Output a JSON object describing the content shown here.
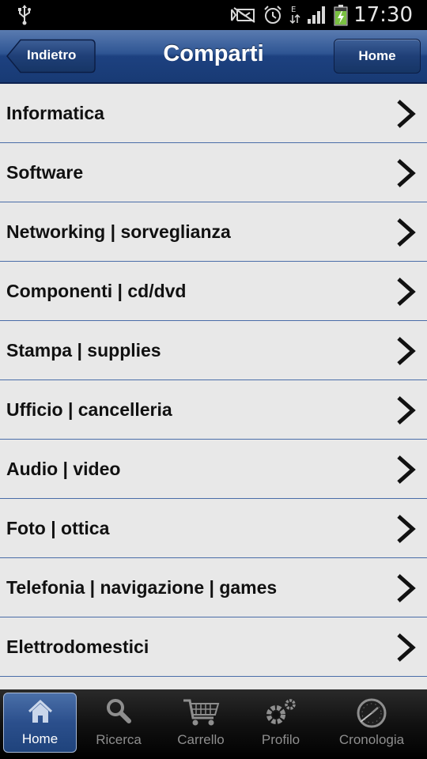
{
  "status_bar": {
    "time": "17:30"
  },
  "nav": {
    "title": "Comparti",
    "back_label": "Indietro",
    "home_label": "Home"
  },
  "list": {
    "items": [
      {
        "label": "Informatica"
      },
      {
        "label": "Software"
      },
      {
        "label": "Networking | sorveglianza"
      },
      {
        "label": "Componenti | cd/dvd"
      },
      {
        "label": "Stampa | supplies"
      },
      {
        "label": "Ufficio | cancelleria"
      },
      {
        "label": "Audio | video"
      },
      {
        "label": "Foto | ottica"
      },
      {
        "label": "Telefonia | navigazione | games"
      },
      {
        "label": "Elettrodomestici"
      }
    ]
  },
  "tabs": [
    {
      "label": "Home",
      "icon": "home-icon",
      "active": true
    },
    {
      "label": "Ricerca",
      "icon": "search-icon",
      "active": false
    },
    {
      "label": "Carrello",
      "icon": "cart-icon",
      "active": false
    },
    {
      "label": "Profilo",
      "icon": "gear-icon",
      "active": false
    },
    {
      "label": "Cronologia",
      "icon": "clock-icon",
      "active": false
    }
  ],
  "colors": {
    "nav_blue": "#2e5593",
    "list_background": "#e8e8e8",
    "divider": "#4a6da8",
    "tabbar": "#111111"
  }
}
